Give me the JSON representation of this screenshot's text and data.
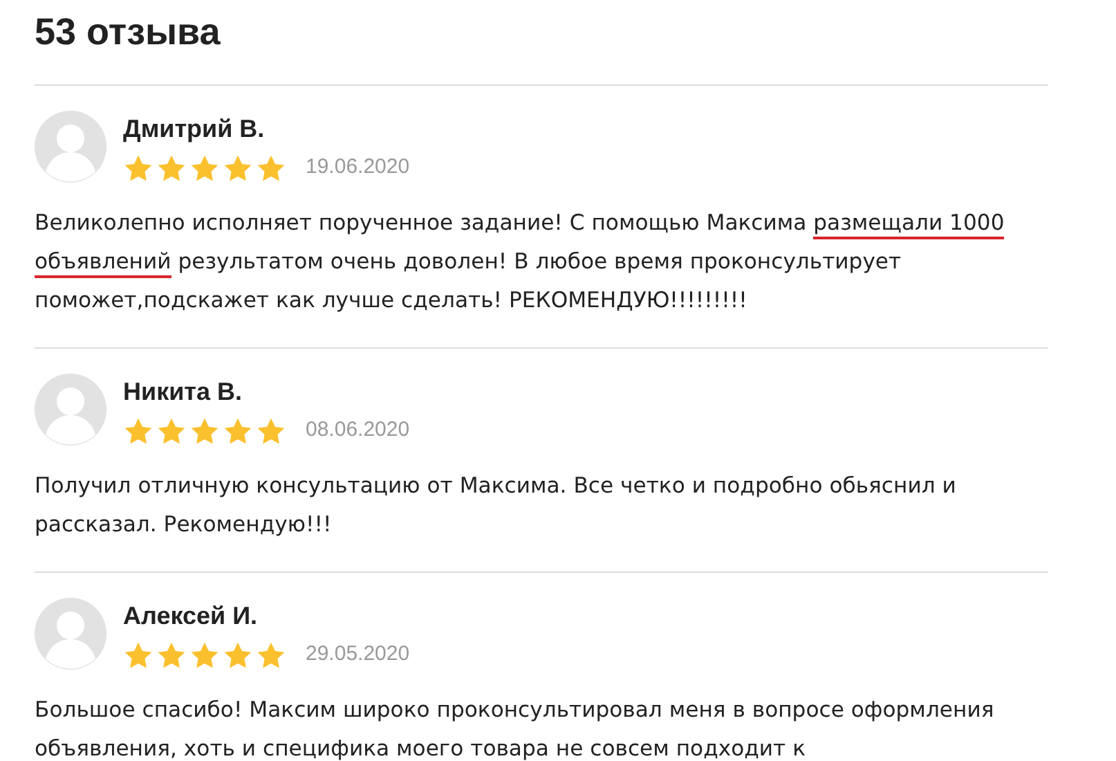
{
  "heading": "53 отзыва",
  "reviews": [
    {
      "name": "Дмитрий В.",
      "stars": 5,
      "date": "19.06.2020",
      "text": [
        {
          "text": "Великолепно исполняет порученное задание! С помощью Максима ",
          "underlined": false
        },
        {
          "text": "размещали 1000 объявлений",
          "underlined": true
        },
        {
          "text": " результатом очень доволен! В любое время проконсультирует поможет,подскажет как лучше сделать! РЕКОМЕНДУЮ!!!!!!!!!",
          "underlined": false
        }
      ]
    },
    {
      "name": "Никита В.",
      "stars": 5,
      "date": "08.06.2020",
      "text": [
        {
          "text": "Получил отличную консультацию от Максима. Все четко и подробно обьяснил и рассказал. Рекомендую!!!",
          "underlined": false
        }
      ]
    },
    {
      "name": "Алексей И.",
      "stars": 5,
      "date": "29.05.2020",
      "text": [
        {
          "text": "Большое спасибо! Максим широко проконсультировал меня в вопросе оформления объявления, хоть и специфика моего товара не совсем подходит к",
          "underlined": false
        }
      ]
    }
  ]
}
